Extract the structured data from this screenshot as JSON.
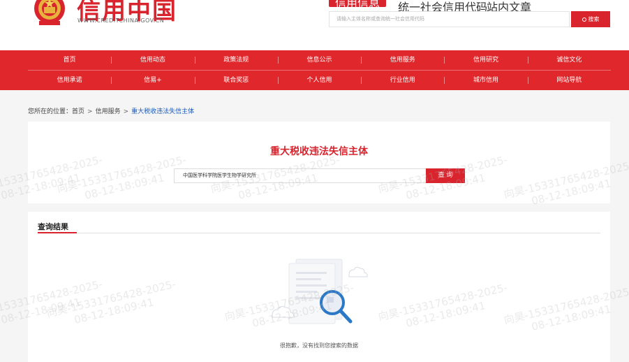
{
  "header": {
    "brand_title": "信用中国",
    "domain": "WWW.CREDITCHINA.GOV.CN",
    "search_tabs": [
      "信用信息",
      "统一社会信用代码",
      "站内文章"
    ],
    "search_placeholder": "请输入主体名称或查询统一社会信用代码",
    "search_button": "搜索",
    "colors": {
      "brand_red": "#d9232d",
      "nav_red": "#e0282c",
      "link_blue": "#1e5bb8"
    }
  },
  "nav": {
    "row1": [
      "首页",
      "信用动态",
      "政策法规",
      "信息公示",
      "信用服务",
      "信用研究",
      "诚信文化"
    ],
    "row2": [
      "信用承诺",
      "信易+",
      "联合奖惩",
      "个人信用",
      "行业信用",
      "城市信用",
      "网站导航"
    ]
  },
  "breadcrumb": {
    "prefix": "您所在的位置：",
    "items": [
      "首页",
      "信用服务"
    ],
    "separator": ">",
    "current": "重大税收违法失信主体"
  },
  "query": {
    "title": "重大税收违法失信主体",
    "input_value": "中国医学科学院医学生物学研究所",
    "button": "查 询"
  },
  "results": {
    "title": "查询结果",
    "empty_message": "很抱歉，没有找到您搜索的数据"
  },
  "watermark": {
    "line1": "向昊-15331765428-2025-",
    "line2": "08-12-18:09:41"
  }
}
